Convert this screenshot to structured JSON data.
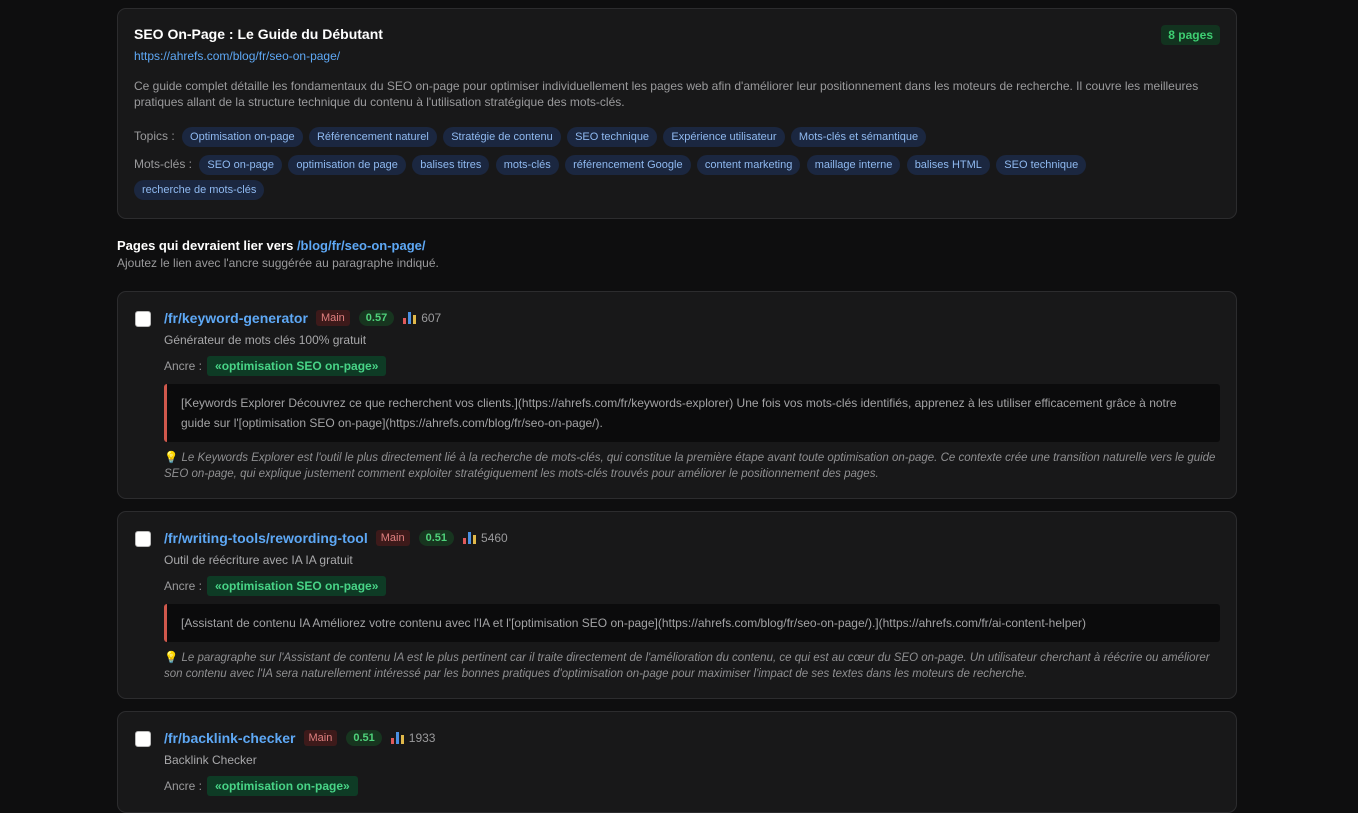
{
  "summary": {
    "title": "SEO On-Page : Le Guide du Débutant",
    "badge": "8 pages",
    "url": "https://ahrefs.com/blog/fr/seo-on-page/",
    "description": "Ce guide complet détaille les fondamentaux du SEO on-page pour optimiser individuellement les pages web afin d'améliorer leur positionnement dans les moteurs de recherche. Il couvre les meilleures pratiques allant de la structure technique du contenu à l'utilisation stratégique des mots-clés.",
    "topics_label": "Topics :",
    "topics": [
      "Optimisation on-page",
      "Référencement naturel",
      "Stratégie de contenu",
      "SEO technique",
      "Expérience utilisateur",
      "Mots-clés et sémantique"
    ],
    "keywords_label": "Mots-clés :",
    "keywords": [
      "SEO on-page",
      "optimisation de page",
      "balises titres",
      "mots-clés",
      "référencement Google",
      "content marketing",
      "maillage interne",
      "balises HTML",
      "SEO technique",
      "recherche de mots-clés"
    ]
  },
  "section": {
    "title_prefix": "Pages qui devraient lier vers",
    "title_path": "/blog/fr/seo-on-page/",
    "subtitle": "Ajoutez le lien avec l'ancre suggérée au paragraphe indiqué."
  },
  "anchor_label": "Ancre :",
  "colors": {
    "accent": "#5ea8f5",
    "score": "#4fd27b",
    "anchor": "#48d487",
    "quote_border": "#d0584c"
  },
  "pages": [
    {
      "path": "/fr/keyword-generator",
      "badge": "Main",
      "score": "0.57",
      "traffic": "607",
      "description": "Générateur de mots clés 100% gratuit",
      "anchor": "«optimisation SEO on-page»",
      "paragraph": "[Keywords Explorer Découvrez ce que recherchent vos clients.](https://ahrefs.com/fr/keywords-explorer) Une fois vos mots-clés identifiés, apprenez à les utiliser efficacement grâce à notre guide sur l'[optimisation SEO on-page](https://ahrefs.com/blog/fr/seo-on-page/).",
      "reason": "Le Keywords Explorer est l'outil le plus directement lié à la recherche de mots-clés, qui constitue la première étape avant toute optimisation on-page. Ce contexte crée une transition naturelle vers le guide SEO on-page, qui explique justement comment exploiter stratégiquement les mots-clés trouvés pour améliorer le positionnement des pages."
    },
    {
      "path": "/fr/writing-tools/rewording-tool",
      "badge": "Main",
      "score": "0.51",
      "traffic": "5460",
      "description": "Outil de réécriture avec IA IA gratuit",
      "anchor": "«optimisation SEO on-page»",
      "paragraph": "[Assistant de contenu IA Améliorez votre contenu avec l'IA et l'[optimisation SEO on-page](https://ahrefs.com/blog/fr/seo-on-page/).](https://ahrefs.com/fr/ai-content-helper)",
      "reason": "Le paragraphe sur l'Assistant de contenu IA est le plus pertinent car il traite directement de l'amélioration du contenu, ce qui est au cœur du SEO on-page. Un utilisateur cherchant à réécrire ou améliorer son contenu avec l'IA sera naturellement intéressé par les bonnes pratiques d'optimisation on-page pour maximiser l'impact de ses textes dans les moteurs de recherche."
    },
    {
      "path": "/fr/backlink-checker",
      "badge": "Main",
      "score": "0.51",
      "traffic": "1933",
      "description": "Backlink Checker",
      "anchor": "«optimisation on-page»",
      "paragraph": "",
      "reason": ""
    }
  ]
}
